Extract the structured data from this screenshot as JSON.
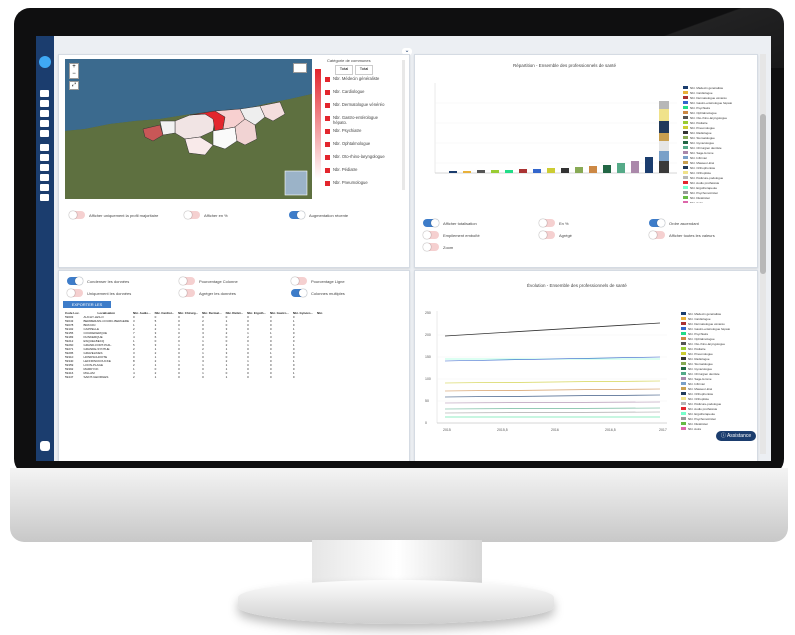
{
  "map_panel": {
    "title": "Catégorie de communes",
    "col_a": "Total",
    "col_b": "Total",
    "items": [
      "Nbr. Médecin généraliste",
      "Nbr. Cardiologue",
      "Nbr. Dermatologue vénéréo",
      "Nbr. Gastro-entérologue hépato.",
      "Nbr. Psychiatre",
      "Nbr. Ophtalmologue",
      "Nbr. Oto-rhino-laryngologue",
      "Nbr. Pédiatre",
      "Nbr. Pneumologue"
    ],
    "toggle1": "Afficher uniquement la profil majoritaire",
    "toggle2": "Afficher en %",
    "toggle3": "Augmentation récente"
  },
  "bar_panel": {
    "title": "Répartition - Ensemble des professionnels de santé",
    "options": [
      "Afficher totalisation",
      "En %",
      "Ordre ascendant",
      "Empilement emboîté",
      "Agrégé",
      "Afficher toutes les valeurs",
      "Zoom"
    ]
  },
  "table_panel": {
    "opts": [
      "Condenser les données",
      "Pourcentage Colonne",
      "Pourcentage Ligne",
      "Uniquement les données",
      "Agréger les données",
      "Colonnes multiples"
    ],
    "export_label": "EXPORTER LES DONNÉES",
    "headers": [
      "Code Loc.",
      "Localisation",
      "Nbr. Audio...",
      "Nbr. Cardiol...",
      "Nbr. Chirurg...",
      "Nbr. Dermat...",
      "Nbr. Diétét...",
      "Nbr. Ergoth...",
      "Nbr. Gastro...",
      "Nbr. Gynéco...",
      "Nbr."
    ],
    "rows": [
      [
        "59003",
        "AUCHY-LES-O",
        "0",
        "0",
        "0",
        "0",
        "0",
        "0",
        "0",
        "0"
      ],
      [
        "59043",
        "BERMERAIN-COURC-BERGERE",
        "3",
        "5",
        "0",
        "2",
        "1",
        "0",
        "0",
        "1"
      ],
      [
        "59078",
        "BRAYAN",
        "1",
        "1",
        "0",
        "0",
        "0",
        "0",
        "0",
        "0"
      ],
      [
        "59102",
        "CAPPELLE",
        "2",
        "2",
        "1",
        "0",
        "3",
        "0",
        "0",
        "1"
      ],
      [
        "59155",
        "COUDEKERQUE",
        "7",
        "3",
        "0",
        "3",
        "2",
        "1",
        "1",
        "0"
      ],
      [
        "59183",
        "DUNKERQUE",
        "4",
        "6",
        "2",
        "4",
        "0",
        "2",
        "3",
        "2"
      ],
      [
        "59212",
        "ESQUELBECQ",
        "1",
        "0",
        "0",
        "1",
        "0",
        "0",
        "0",
        "0"
      ],
      [
        "59260",
        "GRAND-FORT-PHIL.",
        "5",
        "3",
        "1",
        "0",
        "2",
        "1",
        "0",
        "1"
      ],
      [
        "59271",
        "GRANDE-SYNTHE",
        "2",
        "1",
        "0",
        "2",
        "1",
        "0",
        "0",
        "0"
      ],
      [
        "59295",
        "GRAVELINES",
        "3",
        "2",
        "0",
        "1",
        "3",
        "0",
        "1",
        "0"
      ],
      [
        "59310",
        "HONDSCHOOTE",
        "0",
        "1",
        "0",
        "0",
        "0",
        "0",
        "0",
        "0"
      ],
      [
        "59340",
        "LEFFRINCKOUCKE",
        "8",
        "2",
        "1",
        "3",
        "2",
        "1",
        "0",
        "1"
      ],
      [
        "59359",
        "LOON-PLAGE",
        "2",
        "1",
        "0",
        "1",
        "1",
        "0",
        "0",
        "0"
      ],
      [
        "59392",
        "MARDYCK",
        "1",
        "0",
        "0",
        "0",
        "1",
        "0",
        "0",
        "0"
      ],
      [
        "59416",
        "MILLAM",
        "4",
        "2",
        "0",
        "1",
        "0",
        "0",
        "0",
        "1"
      ],
      [
        "59447",
        "SAINT-GEORGES",
        "2",
        "1",
        "0",
        "0",
        "1",
        "0",
        "0",
        "0"
      ]
    ]
  },
  "line_panel": {
    "title": "Évolution - Ensemble des professionnels de santé",
    "x_ticks": [
      "2015",
      "2015,5",
      "2016",
      "2016,5",
      "2017"
    ],
    "y_ticks": [
      "0",
      "50",
      "100",
      "150",
      "200",
      "250"
    ]
  },
  "assistance_label": "Assistance",
  "legend_items": [
    "Nbr. Médecin généraliste",
    "Nbr. Cardiologue",
    "Nbr. Dermatologue vénéréo",
    "Nbr. Gastro-entérologue hépato",
    "Nbr. Psychiatre",
    "Nbr. Ophtalmologue",
    "Nbr. Oto-rhino-laryngologue",
    "Nbr. Pédiatre",
    "Nbr. Pneumologue",
    "Nbr. Radiologue",
    "Nbr. Stomatologue",
    "Nbr. Gynécologue",
    "Nbr. Chirurgien dentiste",
    "Nbr. Sage-femme",
    "Nbr. Infirmier",
    "Nbr. Masseur-kiné",
    "Nbr. Orthophoniste",
    "Nbr. Orthoptiste",
    "Nbr. Pédicure-podologue",
    "Nbr. Audio prothésiste",
    "Nbr. Ergothérapeute",
    "Nbr. Psychomotricien",
    "Nbr. Diététicien",
    "Nbr. Autre"
  ],
  "colors": {
    "sidebar": "#1b3d6e",
    "accent": "#3d7cc9",
    "toggle_off": "#f5d0d0",
    "map_red": "#e3262d"
  }
}
